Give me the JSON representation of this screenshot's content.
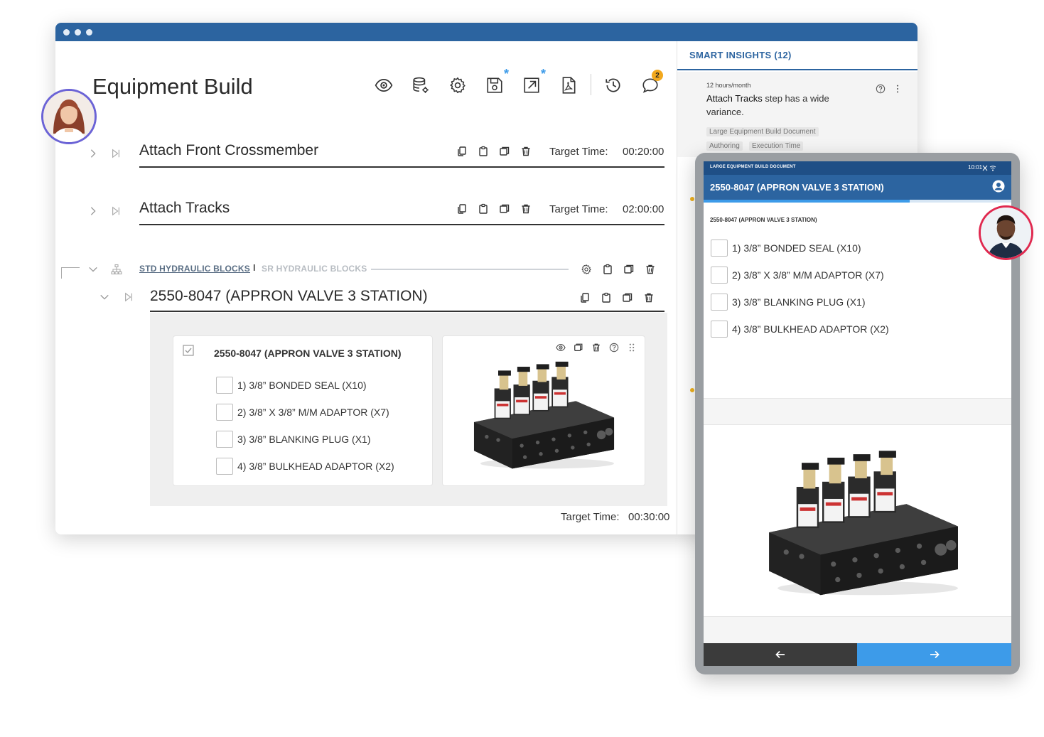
{
  "page": {
    "title": "Equipment Build",
    "toolbar_badge": "2",
    "toolbar_icons": [
      "eye-icon",
      "database-settings-icon",
      "gear-icon",
      "save-icon",
      "export-icon",
      "pdf-icon",
      "history-icon",
      "comments-icon"
    ]
  },
  "steps": [
    {
      "name": "Attach Front Crossmember",
      "target_label": "Target Time:",
      "target_value": "00:20:00"
    },
    {
      "name": "Attach Tracks",
      "target_label": "Target Time:",
      "target_value": "02:00:00"
    }
  ],
  "group": {
    "tab_active": "STD HYDRAULIC BLOCKS",
    "separator": "I",
    "tab_inactive": "SR HYDRAULIC BLOCKS",
    "sub_step": {
      "name": "2550-8047 (APPRON VALVE 3 STATION)",
      "card_title": "2550-8047 (APPRON VALVE 3 STATION)",
      "items": [
        "1) 3/8” BONDED SEAL (X10)",
        "2) 3/8” X 3/8” M/M ADAPTOR (X7)",
        "3) 3/8” BLANKING PLUG (X1)",
        "4) 3/8” BULKHEAD ADAPTOR (X2)"
      ]
    },
    "target_label": "Target Time:",
    "target_value": "00:30:00"
  },
  "insights": {
    "title": "SMART INSIGHTS (12)",
    "card": {
      "meta": "12 hours/month",
      "highlight": "Attach Tracks",
      "text": " step has a wide variance.",
      "tags": [
        "Large Equipment Build Document",
        "Authoring",
        "Execution Time"
      ]
    }
  },
  "tablet": {
    "status_left": "LARGE EQUIPMENT BUILD DOCUMENT",
    "status_time": "10:01",
    "header_title": "2550-8047 (APPRON VALVE 3 STATION)",
    "progress": 0.67,
    "sub_title": "2550-8047 (APPRON VALVE 3 STATION)",
    "items": [
      "1) 3/8” BONDED SEAL (X10)",
      "2) 3/8” X 3/8” M/M ADAPTOR (X7)",
      "3) 3/8” BLANKING PLUG (X1)",
      "4) 3/8” BULKHEAD ADAPTOR (X2)"
    ]
  },
  "colors": {
    "brand_blue": "#2c64a0",
    "accent_blue": "#3d9be9",
    "badge_orange": "#f2a81d",
    "avatar_ring_a": "#6b63d6",
    "avatar_ring_b": "#e0294f"
  }
}
